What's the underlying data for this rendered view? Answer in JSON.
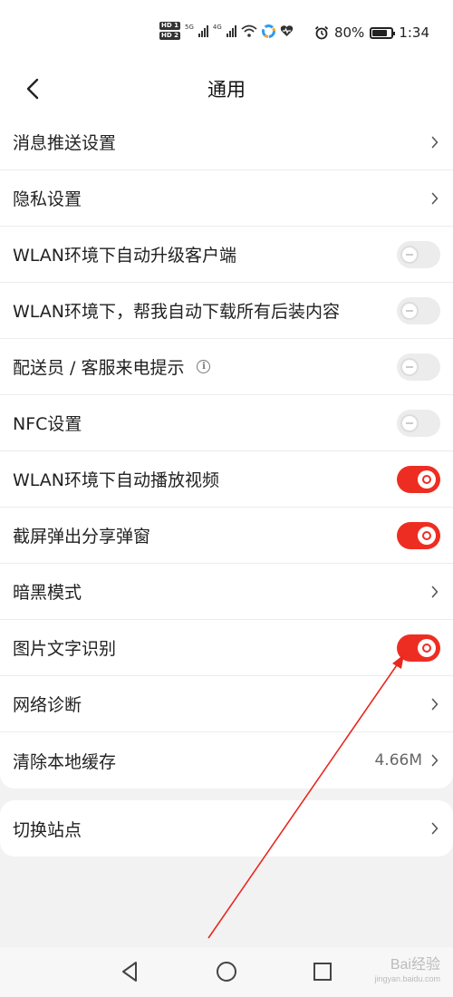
{
  "status_bar": {
    "sim1": "HD 1",
    "sim2": "HD 2",
    "net1": "5G",
    "net2": "4G",
    "battery": "80%",
    "battery_level": 0.8,
    "time": "1:34"
  },
  "header": {
    "title": "通用"
  },
  "settings": {
    "items": [
      {
        "label": "消息推送设置",
        "control": "chevron"
      },
      {
        "label": "隐私设置",
        "control": "chevron"
      },
      {
        "label": "WLAN环境下自动升级客户端",
        "control": "toggle",
        "state": "off"
      },
      {
        "label": "WLAN环境下，帮我自动下载所有后装内容",
        "control": "toggle",
        "state": "off"
      },
      {
        "label": "配送员 / 客服来电提示",
        "control": "toggle",
        "state": "off",
        "info_icon": "info-icon"
      },
      {
        "label": "NFC设置",
        "control": "toggle",
        "state": "off"
      },
      {
        "label": "WLAN环境下自动播放视频",
        "control": "toggle",
        "state": "on"
      },
      {
        "label": "截屏弹出分享弹窗",
        "control": "toggle",
        "state": "on"
      },
      {
        "label": "暗黑模式",
        "control": "chevron"
      },
      {
        "label": "图片文字识别",
        "control": "toggle",
        "state": "on"
      },
      {
        "label": "网络诊断",
        "control": "chevron"
      },
      {
        "label": "清除本地缓存",
        "control": "chevron",
        "value": "4.66M"
      }
    ],
    "group2": [
      {
        "label": "切换站点",
        "control": "chevron"
      }
    ]
  },
  "colors": {
    "accent": "#ee2d22",
    "background": "#f2f2f2",
    "toggle_off": "#ececec"
  },
  "watermark": {
    "text": "Bai经验",
    "sub": "jingyan.baidu.com"
  }
}
